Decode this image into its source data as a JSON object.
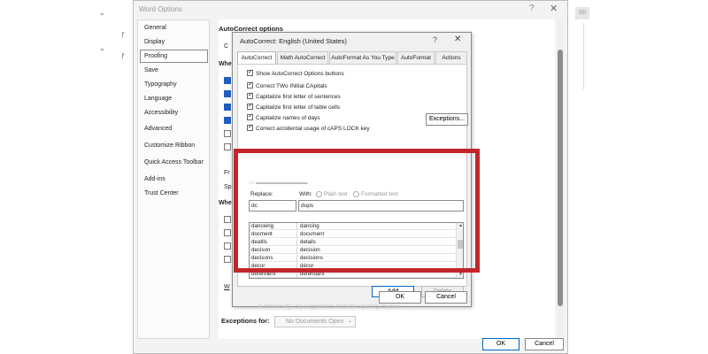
{
  "word_options": {
    "title": "Word Options",
    "help": "?",
    "close": "✕",
    "nav": [
      "General",
      "Display",
      "Proofing",
      "Save",
      "Typography",
      "Language",
      "Accessibility",
      "Advanced",
      "Customize Ribbon",
      "Quick Access Toolbar",
      "Add-ins",
      "Trust Center"
    ],
    "selected_nav": "Proofing",
    "content": {
      "autocorrect_heading": "AutoCorrect options",
      "c_fragment": "C",
      "when1_fragment": "Whe",
      "fr_fragment": "Fr",
      "sp_fragment": "Sp",
      "when2_fragment": "Whe",
      "w_fragment": "W",
      "exceptions_label": "Exceptions for:",
      "no_docs": "No Documents Open"
    },
    "ok": "OK",
    "cancel": "Cancel"
  },
  "autocorrect_dialog": {
    "title": "AutoCorrect: English (United States)",
    "help": "?",
    "close": "✕",
    "tabs": [
      "AutoCorrect",
      "Math AutoCorrect",
      "AutoFormat As You Type",
      "AutoFormat",
      "Actions"
    ],
    "active_tab": "AutoCorrect",
    "options": [
      {
        "label": "Show AutoCorrect Options buttons",
        "checked": true
      },
      {
        "label": "Correct TWo INitial CApitals",
        "checked": true
      },
      {
        "label": "Capitalize first letter of sentences",
        "checked": true
      },
      {
        "label": "Capitalize first letter of table cells",
        "checked": true
      },
      {
        "label": "Capitalize names of days",
        "checked": true
      },
      {
        "label": "Correct accidental usage of cAPS LOCK key",
        "checked": true
      }
    ],
    "exceptions_button": "Exceptions...",
    "replace_label": "Replace:",
    "with_label": "With:",
    "plain_text": "Plain text",
    "formatted_text": "Formatted text",
    "replace_value": "dc",
    "with_value": "dups",
    "entries": [
      {
        "replace": "danceing",
        "with": "dancing"
      },
      {
        "replace": "docment",
        "with": "document"
      },
      {
        "replace": "deatils",
        "with": "details"
      },
      {
        "replace": "decison",
        "with": "decision"
      },
      {
        "replace": "decisons",
        "with": "decisions"
      },
      {
        "replace": "decor",
        "with": "décor"
      },
      {
        "replace": "defendent",
        "with": "defendant"
      }
    ],
    "add_button": "Add",
    "delete_button": "Delete",
    "faded_bottom": "Automatically use suggestions from the spelling checker",
    "ok": "OK",
    "cancel": "Cancel"
  },
  "background": {
    "frag1": "Sh",
    "highlight_color": "#c0262c"
  }
}
